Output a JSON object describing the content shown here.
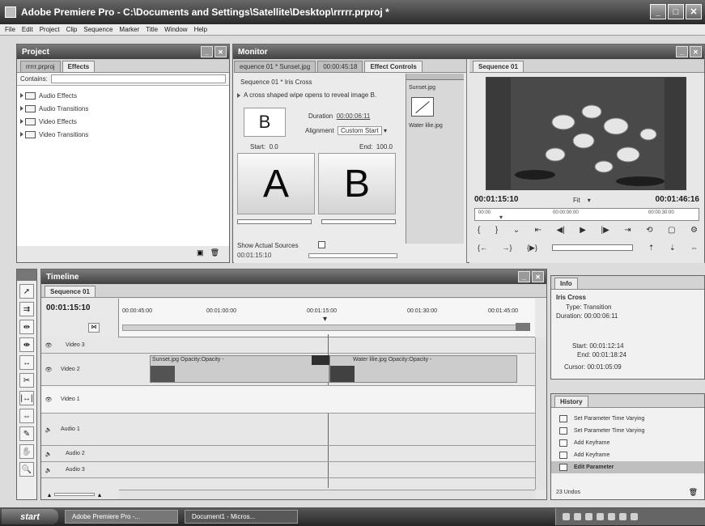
{
  "window": {
    "title": "Adobe Premiere Pro - C:\\Documents and Settings\\Satellite\\Desktop\\rrrrr.prproj *"
  },
  "menu": [
    "File",
    "Edit",
    "Project",
    "Clip",
    "Sequence",
    "Marker",
    "Title",
    "Window",
    "Help"
  ],
  "project_panel": {
    "title": "Project",
    "tabs": [
      "rrrrr.prproj",
      "Effects"
    ],
    "search_label": "Contains:",
    "items": [
      "Audio Effects",
      "Audio Transitions",
      "Video Effects",
      "Video Transitions"
    ]
  },
  "monitor_panel": {
    "title": "Monitor",
    "tabs": [
      "equence 01 * Sunset.jpg",
      "00:00:45:18",
      "Effect Controls"
    ],
    "seq_label": "Sequence 01 * Iris Cross",
    "description": "A cross shaped wipe opens to reveal image B.",
    "icon_letter_b": "B",
    "duration_label": "Duration",
    "duration_value": "00:00:06:11",
    "alignment_label": "Alignment",
    "alignment_value": "Custom Start",
    "start_label": "Start:",
    "start_value": "0.0",
    "end_label": "End:",
    "end_value": "100.0",
    "preview_a": "A",
    "preview_b": "B",
    "clip_a": "Sunset.jpg",
    "clip_b": "Water lilie.jpg",
    "show_sources": "Show Actual Sources",
    "timecode": "00:01:15:10"
  },
  "sequence_monitor": {
    "tab": "Sequence 01",
    "timecode_in": "00:01:15:10",
    "fit": "Fit",
    "timecode_out": "00:01:46:16",
    "ruler": [
      "00:00",
      "00:00:00:00",
      "00:00:30:00"
    ]
  },
  "timeline": {
    "title": "Timeline",
    "tab": "Sequence 01",
    "timecode": "00:01:15:10",
    "ruler": [
      "00:00:45:00",
      "00:01:00:00",
      "00:01:15:00",
      "00:01:30:00",
      "00:01:45:00"
    ],
    "tracks": [
      "Video 3",
      "Video 2",
      "Video 1",
      "Audio 1",
      "Audio 2",
      "Audio 3"
    ],
    "clip1_label": "Sunset.jpg Opacity:Opacity -",
    "clip2_label": "Water lilie.jpg Opacity:Opacity -"
  },
  "info_panel": {
    "tab": "Info",
    "name": "Iris Cross",
    "type_label": "Type:",
    "type_value": "Transition",
    "duration_label": "Duration:",
    "duration_value": "00:00:06:11",
    "start_label": "Start:",
    "start_value": "00:01:12:14",
    "end_label": "End:",
    "end_value": "00:01:18:24",
    "cursor_label": "Cursor:",
    "cursor_value": "00:01:05:09"
  },
  "history_panel": {
    "tab": "History",
    "items": [
      "Set Parameter Time Varying",
      "Set Parameter Time Varying",
      "Add Keyframe",
      "Add Keyframe",
      "Edit Parameter"
    ],
    "undos": "23 Undos"
  },
  "taskbar": {
    "start": "start",
    "tasks": [
      "Adobe Premiere Pro -...",
      "Document1 - Micros..."
    ]
  }
}
